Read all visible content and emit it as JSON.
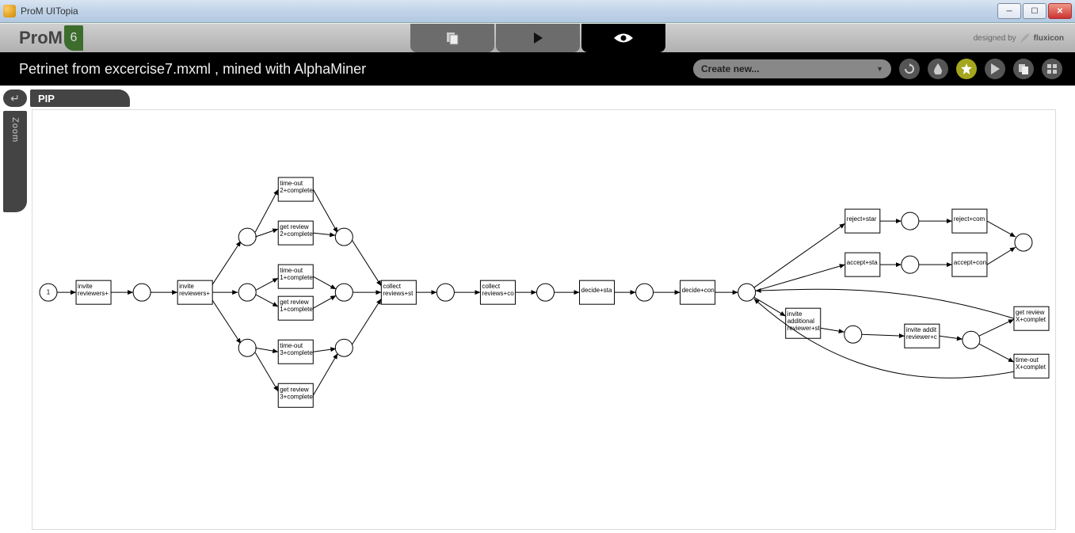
{
  "window_title": "ProM UITopia",
  "logo_text": "ProM",
  "logo_badge": "6",
  "byline": "designed by",
  "byline_brand": "fluxicon",
  "page_title": "Petrinet from excercise7.mxml , mined with AlphaMiner",
  "create_label": "Create new...",
  "sidebar": {
    "back": "↵",
    "pip": "PIP",
    "zoom": "Zoom"
  },
  "nav": {
    "tab1": "workspace",
    "tab2": "run",
    "tab3": "view"
  },
  "round": {
    "refresh": "refresh",
    "drop": "drop",
    "star": "star",
    "play": "play",
    "copy": "copy",
    "grid": "grid"
  },
  "petri": {
    "source_token": "1",
    "transitions": {
      "t_ir": "invite\nreviewers+",
      "t_ir2": "invite\nreviewers+",
      "t_to2": "time-out\n2+complete",
      "t_gr2": "get review\n2+complete",
      "t_to1": "time-out\n1+complete",
      "t_gr1": "get review\n1+complete",
      "t_to3": "time-out\n3+complete",
      "t_gr3": "get review\n3+complete",
      "t_cs": "collect\nreviews+st",
      "t_cc": "collect\nreviews+co",
      "t_ds": "decide+sta",
      "t_dc": "decide+con",
      "t_rs": "reject+star",
      "t_rc": "reject+com",
      "t_as": "accept+sta",
      "t_ac": "accept+con",
      "t_iar": "invite\nadditional\nreviewer+st",
      "t_iac": "invite addit\nreviewer+c",
      "t_grx": "get review\nX+complet",
      "t_tox": "time-out\nX+complet"
    }
  }
}
